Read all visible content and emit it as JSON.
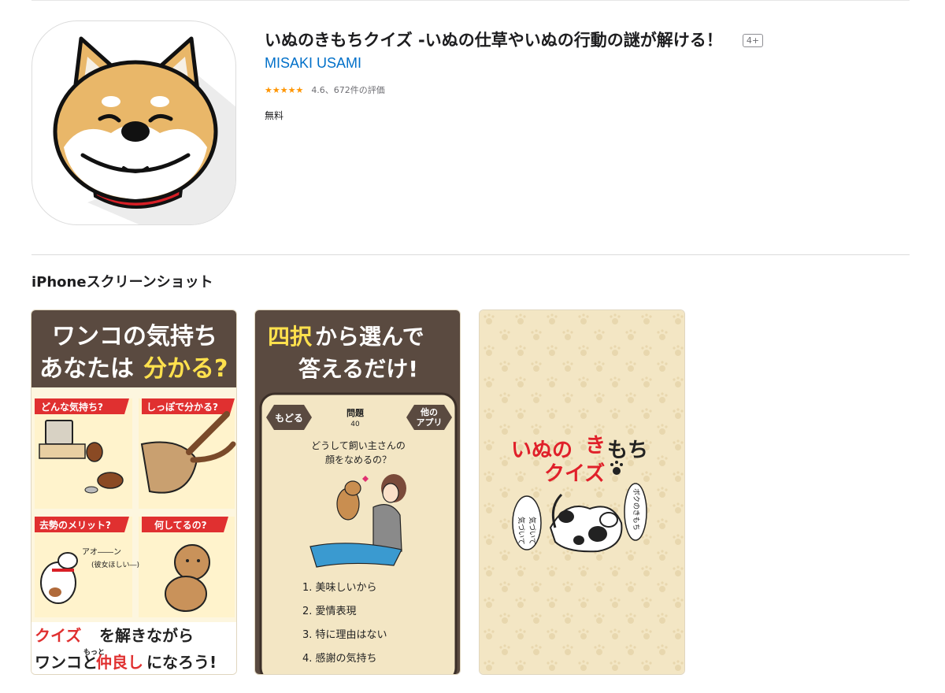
{
  "app": {
    "title": "いぬのきもちクイズ -いぬの仕草やいぬの行動の謎が解ける！",
    "age_rating": "4+",
    "developer": "MISAKI USAMI",
    "stars": "★★★★★",
    "rating_text": "4.6、672件の評価",
    "price": "無料"
  },
  "screenshots_section": {
    "title": "iPhoneスクリーンショット"
  },
  "shot1": {
    "headline_1": "ワンコの気持ち",
    "headline_2a": "あなたは",
    "headline_2b": "分かる?",
    "tag_1": "どんな気持ち?",
    "tag_2": "しっぽで分かる?",
    "tag_3": "去勢のメリット?",
    "tag_4": "何してるの?",
    "bubble": "アオ――ン",
    "bubble_sub": "(彼女ほしい―)",
    "footer_1a": "クイズ",
    "footer_1b": "を解きながら",
    "footer_2a": "ワンコと",
    "footer_2b": "仲良し",
    "footer_2c": "になろう!",
    "ruby": "もっと"
  },
  "shot2": {
    "headline_1a": "四択",
    "headline_1b": "から選んで",
    "headline_2": "答えるだけ!",
    "back_button": "もどる",
    "question_label": "問題",
    "question_number": "40",
    "other_apps_1": "他の",
    "other_apps_2": "アプリ",
    "question_1": "どうして飼い主さんの",
    "question_2": "顔をなめるの？",
    "choices": [
      "1. 美味しいから",
      "2. 愛情表現",
      "3. 特に理由はない",
      "4. 感謝の気持ち"
    ]
  },
  "shot3": {
    "logo_1a": "いぬの",
    "logo_1b": "き",
    "logo_1c": "もち",
    "logo_2": "クイズ",
    "bubble_left_1": "気づいて",
    "bubble_left_2": "気づいて",
    "bubble_right": "ボクのきもち"
  },
  "colors": {
    "link_blue": "#0070c9",
    "star_orange": "#ff9500",
    "banner_brown": "#5a4a40",
    "highlight_yellow": "#ffe14d",
    "tag_red": "#e03030",
    "logo_red": "#e0202a",
    "beige": "#f3e6c4"
  }
}
